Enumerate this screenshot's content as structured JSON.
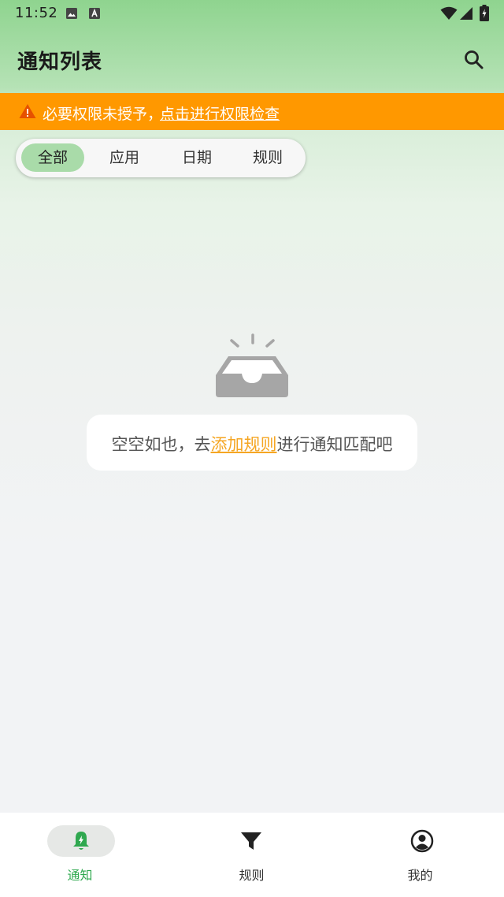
{
  "status_bar": {
    "time": "11:52"
  },
  "header": {
    "title": "通知列表"
  },
  "permission_banner": {
    "text": "必要权限未授予，",
    "link": "点击进行权限检查"
  },
  "filter_tabs": [
    {
      "label": "全部",
      "active": true
    },
    {
      "label": "应用",
      "active": false
    },
    {
      "label": "日期",
      "active": false
    },
    {
      "label": "规则",
      "active": false
    }
  ],
  "empty_state": {
    "prefix": "空空如也，去",
    "link": "添加规则",
    "suffix": "进行通知匹配吧"
  },
  "bottom_nav": [
    {
      "label": "通知",
      "icon": "bell-icon",
      "active": true
    },
    {
      "label": "规则",
      "icon": "filter-icon",
      "active": false
    },
    {
      "label": "我的",
      "icon": "account-circle-icon",
      "active": false
    }
  ],
  "colors": {
    "accent": "#2fa84f",
    "banner": "#ff9800",
    "link": "#f5a623",
    "active_tab": "#a9dba9"
  }
}
